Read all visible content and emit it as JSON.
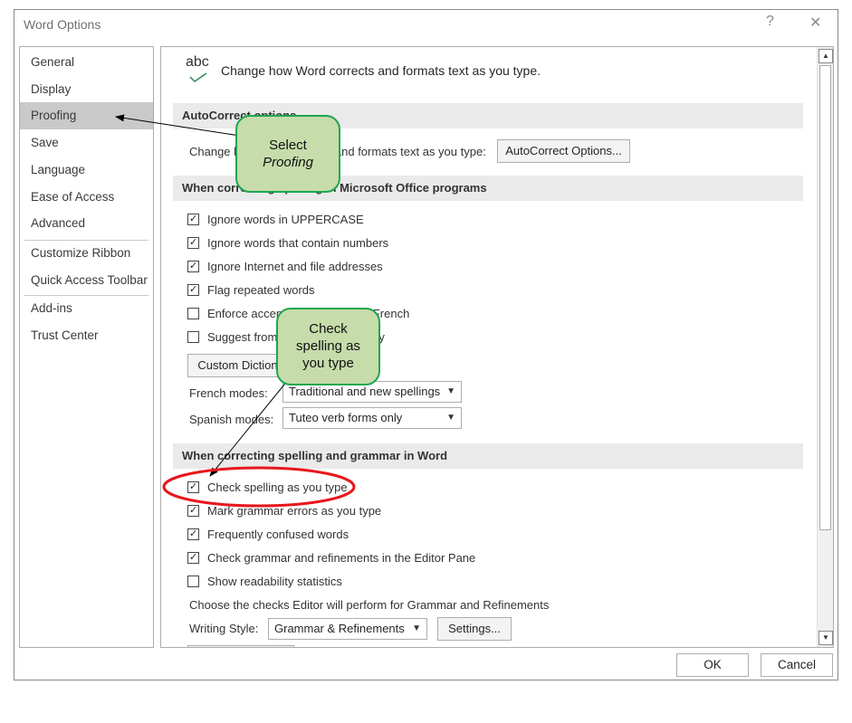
{
  "window": {
    "title": "Word Options",
    "help_glyph": "?",
    "close_glyph": "✕"
  },
  "nav": {
    "items": [
      "General",
      "Display",
      "Proofing",
      "Save",
      "Language",
      "Ease of Access",
      "Advanced",
      "Customize Ribbon",
      "Quick Access Toolbar",
      "Add-ins",
      "Trust Center"
    ],
    "selected": "Proofing"
  },
  "header": {
    "icon_text": "abc",
    "text": "Change how Word corrects and formats text as you type."
  },
  "autocorrect": {
    "title": "AutoCorrect options",
    "desc": "Change how Word corrects and formats text as you type:",
    "button": "AutoCorrect Options..."
  },
  "office": {
    "title": "When correcting spelling in Microsoft Office programs",
    "checks": [
      {
        "label": "Ignore words in UPPERCASE",
        "checked": true
      },
      {
        "label": "Ignore words that contain numbers",
        "checked": true
      },
      {
        "label": "Ignore Internet and file addresses",
        "checked": true
      },
      {
        "label": "Flag repeated words",
        "checked": true
      },
      {
        "label": "Enforce accented uppercase in French",
        "checked": false
      },
      {
        "label": "Suggest from main dictionary only",
        "checked": false
      }
    ],
    "custom_dict_button": "Custom Dictionaries...",
    "french_label": "French modes:",
    "french_value": "Traditional and new spellings",
    "spanish_label": "Spanish modes:",
    "spanish_value": "Tuteo verb forms only"
  },
  "word": {
    "title": "When correcting spelling and grammar in Word",
    "checks": [
      {
        "label": "Check spelling as you type",
        "checked": true
      },
      {
        "label": "Mark grammar errors as you type",
        "checked": true
      },
      {
        "label": "Frequently confused words",
        "checked": true
      },
      {
        "label": "Check grammar and refinements in the Editor Pane",
        "checked": true
      },
      {
        "label": "Show readability statistics",
        "checked": false
      }
    ],
    "choose_text": "Choose the checks Editor will perform for Grammar and Refinements",
    "style_label": "Writing Style:",
    "style_value": "Grammar & Refinements",
    "settings_button": "Settings..."
  },
  "buttons": {
    "ok": "OK",
    "cancel": "Cancel"
  },
  "callouts": {
    "proofing": [
      "Select",
      "Proofing"
    ],
    "spelling": [
      "Check",
      "spelling as",
      "you type"
    ]
  },
  "colors": {
    "callout_fill": "#c6dcaa",
    "callout_border": "#1ea650",
    "highlight": "#e8161d",
    "nav_selected": "#c9c9c9"
  }
}
